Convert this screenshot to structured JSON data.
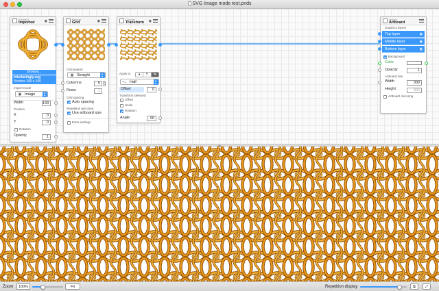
{
  "window": {
    "title": "SVG Image mode test.pnds"
  },
  "colors": {
    "accent": "#3b99fc",
    "ring": "#e9a22b",
    "ring_dark": "#9a5a07"
  },
  "nodes": {
    "imported": {
      "category": "Element",
      "name": "Imported",
      "browse_label": "Browse...",
      "file_name": "interlacingly.svg",
      "file_info": "Vectors 100 x 100",
      "import_mode_label": "Import mode",
      "import_mode_value": "Image",
      "width_label": "Width",
      "width_value": "143",
      "position_label": "Position",
      "x_label": "X",
      "x_value": "0",
      "y_label": "Y",
      "y_value": "0",
      "rotation_label": "Rotation",
      "opacity_label": "Opacity",
      "opacity_value": "1"
    },
    "grid": {
      "category": "Repeat",
      "name": "Grid",
      "pattern_label": "Grid pattern",
      "pattern_value": "Straight",
      "columns_label": "Columns",
      "columns_value": "5",
      "rows_label": "Rows",
      "rows_value": "1",
      "spacing_label": "Grid spacing",
      "auto_spacing_label": "Auto spacing",
      "area_label": "Repetition grid area",
      "use_artboard_label": "Use artboard size",
      "extra_label": "Extra settings"
    },
    "transform": {
      "category": "Change",
      "name": "Transform",
      "apply_label": "Apply to",
      "apply_options": [
        "●",
        "⠿",
        "⇆"
      ],
      "half_value": "Half",
      "offset_label": "Offset",
      "offset_value": "0",
      "selected_label": "Transform selected",
      "offset_chk": "Offset",
      "scale_chk": "Scale",
      "rotation_chk": "Rotation",
      "angle_label": "Angle",
      "angle_value": "90"
    },
    "artboard": {
      "category": "Output",
      "name": "Artboard",
      "layers_label": "Graphics layers",
      "layers": [
        "Top layer",
        "Middle layer",
        "Bottom layer"
      ],
      "background_label": "Background",
      "color_label": "Color",
      "opacity_label": "Opacity",
      "opacity_value": "1",
      "size_label": "Artboard size",
      "width_label": "Width",
      "width_value": "300",
      "height_label": "Height",
      "height_value": "300",
      "mirroring_label": "Artboard mirroring"
    }
  },
  "status": {
    "zoom_label": "Zoom",
    "zoom_value": "100%",
    "fit_label": "Fit",
    "repetition_label": "Repetition display",
    "repetition_level": 0.85
  }
}
